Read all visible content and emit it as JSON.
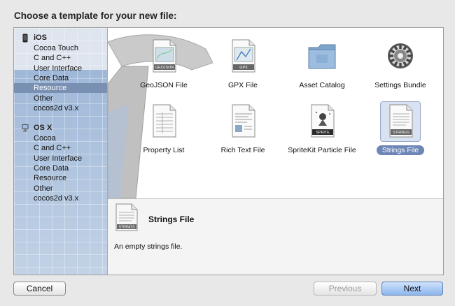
{
  "dialog": {
    "title": "Choose a template for your new file:"
  },
  "sidebar": {
    "groups": [
      {
        "label": "iOS",
        "icon": "iphone-icon",
        "items": [
          {
            "label": "Cocoa Touch"
          },
          {
            "label": "C and C++"
          },
          {
            "label": "User Interface"
          },
          {
            "label": "Core Data"
          },
          {
            "label": "Resource",
            "selected": true
          },
          {
            "label": "Other"
          },
          {
            "label": "cocos2d v3.x"
          }
        ]
      },
      {
        "label": "OS X",
        "icon": "mac-icon",
        "items": [
          {
            "label": "Cocoa"
          },
          {
            "label": "C and C++"
          },
          {
            "label": "User Interface"
          },
          {
            "label": "Core Data"
          },
          {
            "label": "Resource"
          },
          {
            "label": "Other"
          },
          {
            "label": "cocos2d v3.x"
          }
        ]
      }
    ]
  },
  "templates": [
    {
      "label": "GeoJSON File",
      "icon": "geojson-file-icon",
      "badge": "GEOJSON"
    },
    {
      "label": "GPX File",
      "icon": "gpx-file-icon",
      "badge": "GPX"
    },
    {
      "label": "Asset Catalog",
      "icon": "folder-icon"
    },
    {
      "label": "Settings Bundle",
      "icon": "settings-gear-icon"
    },
    {
      "label": "Property List",
      "icon": "property-list-icon"
    },
    {
      "label": "Rich Text File",
      "icon": "rich-text-file-icon"
    },
    {
      "label": "SpriteKit Particle File",
      "icon": "sprite-file-icon",
      "badge": "SPRITE"
    },
    {
      "label": "Strings File",
      "icon": "strings-file-icon",
      "badge": "STRINGS",
      "selected": true
    }
  ],
  "detail": {
    "title": "Strings File",
    "description": "An empty strings file.",
    "badge": "STRINGS"
  },
  "buttons": {
    "cancel": "Cancel",
    "previous": "Previous",
    "next": "Next"
  },
  "colors": {
    "selection": "#7990b3",
    "primary_button": "#8db6ee"
  }
}
